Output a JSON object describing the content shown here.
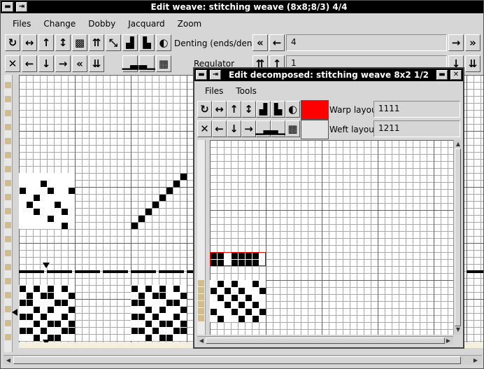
{
  "main": {
    "title": "Edit weave: stitching weave (8x8;8/3) 4/4",
    "menu": [
      "Files",
      "Change",
      "Dobby",
      "Jacquard",
      "Zoom"
    ],
    "denting_label": "Denting (ends/dent)",
    "denting_value": "4",
    "regulator_label": "Regulator",
    "regulator_value": "1"
  },
  "decomposed": {
    "title": "Edit decomposed: stitching weave 8x2 1/2",
    "menu": [
      "Files",
      "Tools"
    ],
    "warp_layout_label": "Warp layout",
    "warp_layout_value": "1111",
    "weft_layout_label": "Weft layout",
    "weft_layout_value": "1211",
    "warp_swatch_color": "#ff0000",
    "weft_swatch_color": "#e4e4e4"
  },
  "icons": {
    "title_buttons": [
      "minimize-icon",
      "pin-icon",
      "close-icon"
    ],
    "row1": [
      "rotate-icon",
      "mirror-horizontal-icon",
      "shift-up-icon",
      "mirror-vertical-icon",
      "invert-icon",
      "fast-up-icon",
      "diagonal-icon",
      "twill-right-icon",
      "twill-left-icon",
      "half-fill-icon"
    ],
    "row2": [
      "clear-icon",
      "shift-left-icon",
      "shift-down-icon",
      "shift-right-icon",
      "fast-left-icon",
      "fast-down-icon",
      "step-up-icon",
      "step-down-icon",
      "checker-icon"
    ],
    "denting_nav": [
      "double-left-icon",
      "left-icon",
      "right-icon",
      "double-right-icon"
    ],
    "regulator_nav": [
      "double-up-icon",
      "up-icon",
      "down-icon",
      "double-down-icon"
    ]
  },
  "colors": {
    "title_bar": "#000000",
    "window_bg": "#d6d6d6",
    "yarn_tan": "#d2bc8c",
    "selection_red": "#ff0000"
  }
}
